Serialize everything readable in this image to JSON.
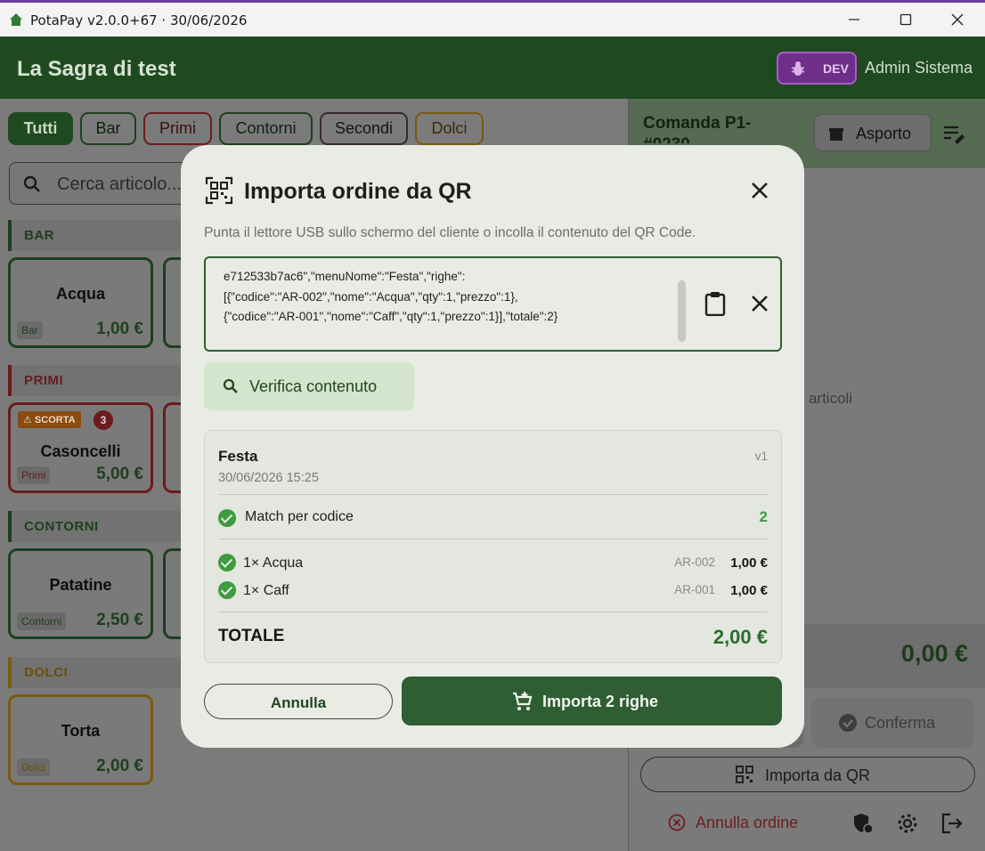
{
  "window": {
    "title": "PotaPay  v2.0.0+67  ·  30/06/2026",
    "minimize_icon": "minimize-icon",
    "maximize_icon": "maximize-icon",
    "close_icon": "close-icon"
  },
  "header": {
    "event_name": "La Sagra di test",
    "env_badge": "DEV",
    "user": "Admin Sistema"
  },
  "categories": [
    {
      "label": "Tutti",
      "selected": true,
      "color": "#1f4a1f"
    },
    {
      "label": "Bar",
      "color": "#2e5e2e"
    },
    {
      "label": "Primi",
      "color": "#8a2020"
    },
    {
      "label": "Contorni",
      "color": "#2e5e2e"
    },
    {
      "label": "Secondi",
      "color": "#4a3030"
    },
    {
      "label": "Dolci",
      "color": "#8a6a10"
    }
  ],
  "search": {
    "placeholder": "Cerca articolo..."
  },
  "sections": {
    "bar": "BAR",
    "primi": "PRIMI",
    "contorni": "CONTORNI",
    "dolci": "DOLCI"
  },
  "products": {
    "acqua": {
      "name": "Acqua",
      "tag": "Bar",
      "price": "1,00 €"
    },
    "casoncelli": {
      "name": "Casoncelli",
      "tag": "Primi",
      "price": "5,00 €",
      "stock_badge": "⚠ SCORTA",
      "stock_count": "3"
    },
    "patatine": {
      "name": "Patatine",
      "tag": "Contorni",
      "price": "2,50 €"
    },
    "torta": {
      "name": "Torta",
      "tag": "Dolci",
      "price": "2,00 €"
    }
  },
  "order_panel": {
    "title": "Comanda P1-#0230",
    "asporto": "Asporto",
    "empty_hint": "gi articoli",
    "total": "0,00 €",
    "confirm": "Conferma",
    "import_qr": "Importa da QR",
    "cancel_order": "Annulla ordine"
  },
  "modal": {
    "title": "Importa ordine da QR",
    "subtitle": "Punta il lettore USB sullo schermo del cliente o incolla il contenuto del QR Code.",
    "qr_lines": [
      "e712533b7ac6\",\"menuNome\":\"Festa\",\"righe\":",
      "[{\"codice\":\"AR-002\",\"nome\":\"Acqua\",\"qty\":1,\"prezzo\":1},",
      "{\"codice\":\"AR-001\",\"nome\":\"Caff\",\"qty\":1,\"prezzo\":1}],\"totale\":2}"
    ],
    "verify": "Verifica contenuto",
    "preview": {
      "menu": "Festa",
      "datetime": "30/06/2026 15:25",
      "version": "v1",
      "match_label": "Match per codice",
      "match_count": "2",
      "rows": [
        {
          "label": "1× Acqua",
          "code": "AR-002",
          "price": "1,00 €"
        },
        {
          "label": "1× Caff",
          "code": "AR-001",
          "price": "1,00 €"
        }
      ],
      "total_label": "TOTALE",
      "total_value": "2,00 €"
    },
    "cancel": "Annulla",
    "import": "Importa 2 righe"
  }
}
